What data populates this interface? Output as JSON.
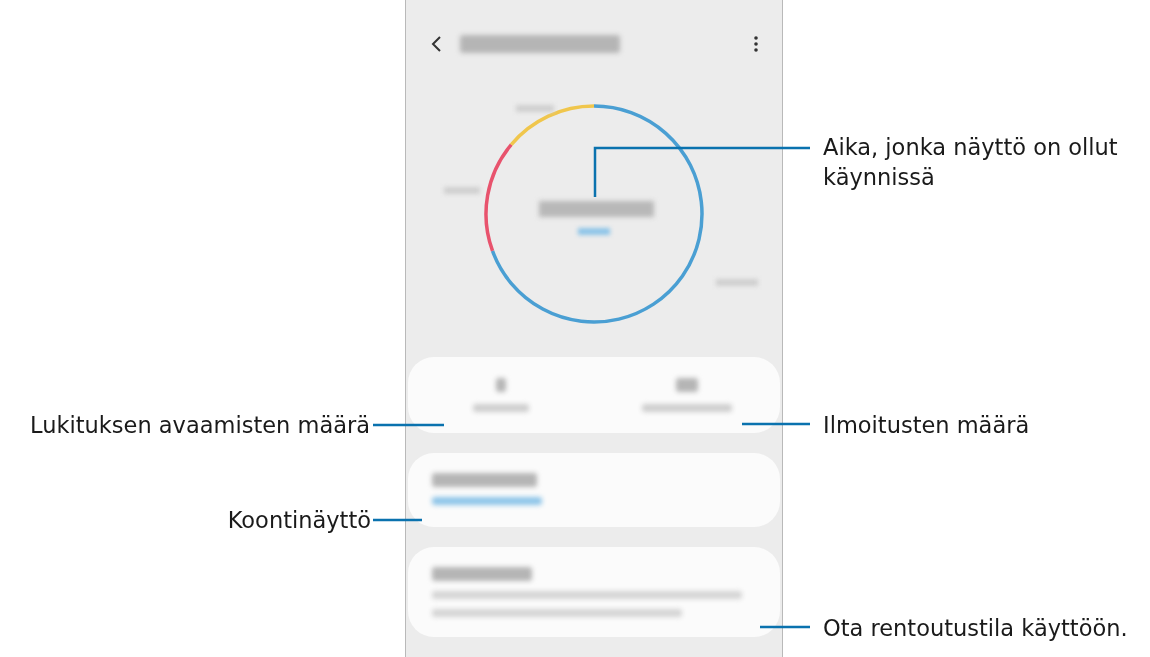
{
  "callouts": [
    {
      "text": "Aika, jonka näyttö on ollut käynnissä"
    },
    {
      "text": "Lukituksen avaamisten määrä"
    },
    {
      "text": "Ilmoitusten määrä"
    },
    {
      "text": "Koontinäyttö"
    },
    {
      "text": "Ota rentoutustila käyttöön."
    }
  ]
}
